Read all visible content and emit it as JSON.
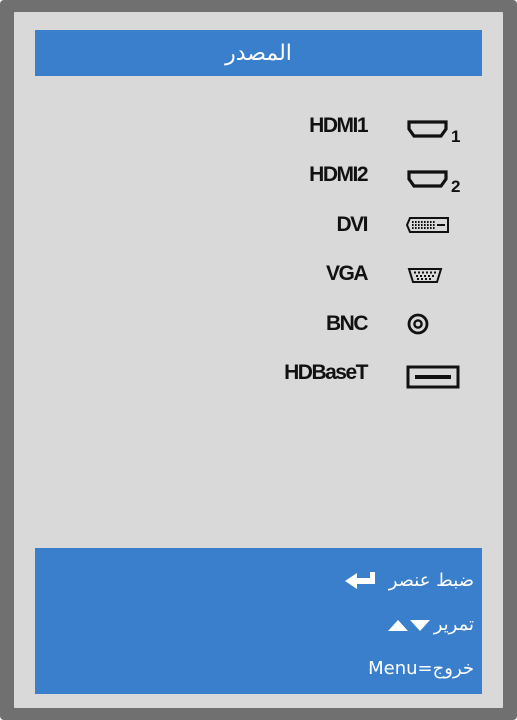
{
  "menu": {
    "title": "المصدر",
    "sources": [
      {
        "label": "HDMI1",
        "icon": "hdmi-1-icon"
      },
      {
        "label": "HDMI2",
        "icon": "hdmi-2-icon"
      },
      {
        "label": "DVI",
        "icon": "dvi-icon"
      },
      {
        "label": "VGA",
        "icon": "vga-icon"
      },
      {
        "label": "BNC",
        "icon": "bnc-icon"
      },
      {
        "label": "HDBaseT",
        "icon": "hdbaset-icon"
      }
    ],
    "hdmi1_sub": "1",
    "hdmi2_sub": "2"
  },
  "help": {
    "select_label": "ضبط عنصر",
    "scroll_label": "تمرير",
    "exit_label": "خروج=Menu"
  },
  "colors": {
    "frame": "#707070",
    "panel": "#d9d9d9",
    "accent": "#3a7fcb",
    "text": "#111111"
  }
}
